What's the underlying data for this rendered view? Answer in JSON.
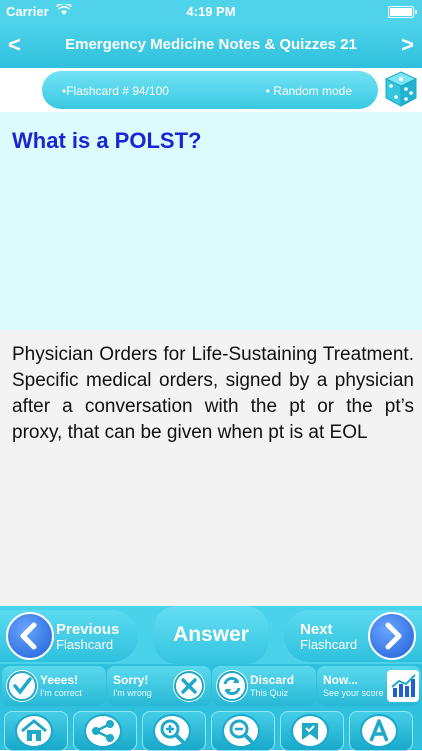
{
  "status": {
    "carrier": "Carrier",
    "time": "4:19 PM"
  },
  "nav": {
    "title": "Emergency Medicine Notes & Quizzes 21",
    "back": "<",
    "forward": ">"
  },
  "info": {
    "flashcard": "•Flashcard # 94/100",
    "mode": "• Random mode"
  },
  "question": "What is a POLST?",
  "answer": "Physician Orders for Life-Sustaining Treatment. Specific medical orders, signed by a physician after a conversation with the pt or the pt’s proxy, that can be given when pt is at EOL",
  "controls": {
    "previous": {
      "line1": "Previous",
      "line2": "Flashcard"
    },
    "answer": "Answer",
    "next": {
      "line1": "Next",
      "line2": "Flashcard"
    }
  },
  "actions": [
    {
      "line1": "Yeees!",
      "line2": "I'm correct",
      "icon": "check-icon"
    },
    {
      "line1": "Sorry!",
      "line2": "I'm wrong",
      "icon": "cross-icon"
    },
    {
      "line1": "Discard",
      "line2": "This Quiz",
      "icon": "recycle-icon"
    },
    {
      "line1": "Now...",
      "line2": "See your score",
      "icon": "chart-icon"
    }
  ],
  "tools": [
    "home-icon",
    "share-icon",
    "zoom-in-icon",
    "zoom-out-icon",
    "bookmark-icon",
    "font-icon"
  ],
  "colors": {
    "accent": "#2fc0dd",
    "question_bg": "#dcfbfd",
    "question_text": "#1a25d6",
    "answer_bg": "#f3f3f3"
  }
}
